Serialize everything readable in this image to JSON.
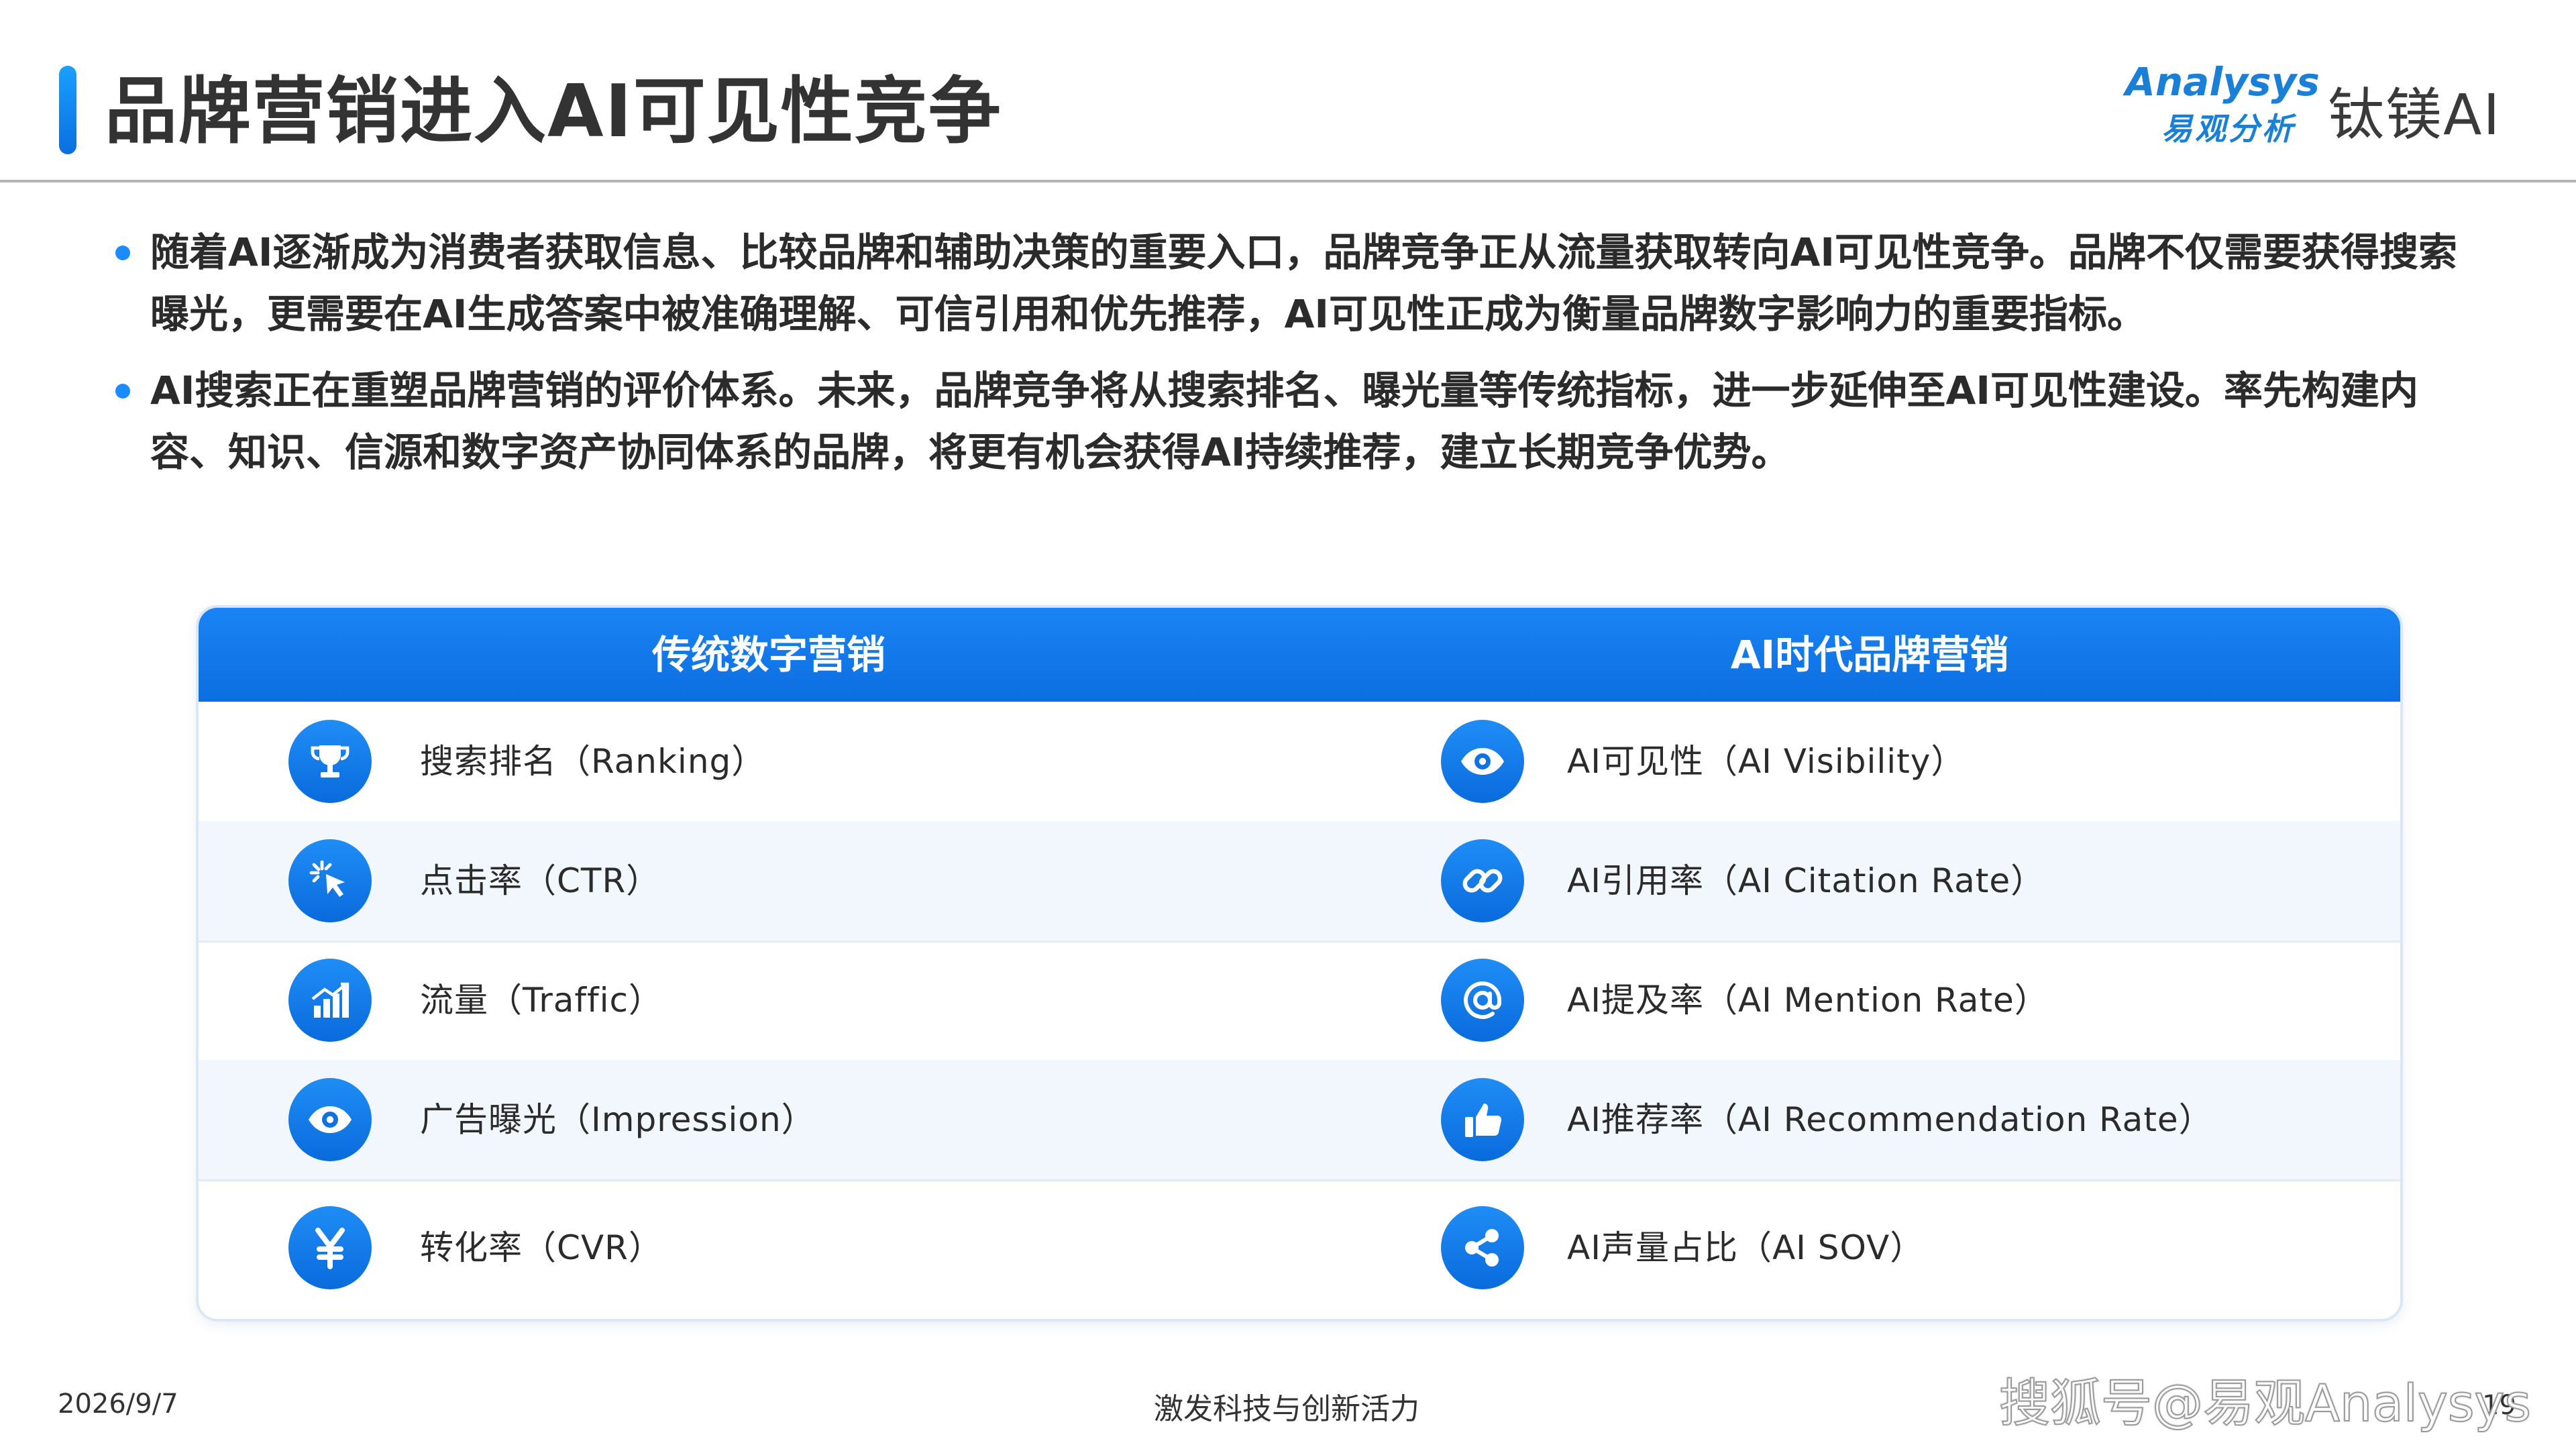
{
  "header": {
    "title": "品牌营销进入AI可见性竞争",
    "logo_analysys_wordmark": "Analysys",
    "logo_analysys_cn": "易观分析",
    "logo_tiemei": "钛镁AI"
  },
  "bullets": [
    "随着AI逐渐成为消费者获取信息、比较品牌和辅助决策的重要入口，品牌竞争正从流量获取转向AI可见性竞争。品牌不仅需要获得搜索曝光，更需要在AI生成答案中被准确理解、可信引用和优先推荐，AI可见性正成为衡量品牌数字影响力的重要指标。",
    "AI搜索正在重塑品牌营销的评价体系。未来，品牌竞争将从搜索排名、曝光量等传统指标，进一步延伸至AI可见性建设。率先构建内容、知识、信源和数字资产协同体系的品牌，将更有机会获得AI持续推荐，建立长期竞争优势。"
  ],
  "table": {
    "left_header": "传统数字营销",
    "right_header": "AI时代品牌营销",
    "rows": [
      {
        "left": "搜索排名（Ranking）",
        "left_icon": "trophy-icon",
        "right": "AI可见性（AI Visibility）",
        "right_icon": "eye-icon"
      },
      {
        "left": "点击率（CTR）",
        "left_icon": "cursor-click-icon",
        "right": "AI引用率（AI Citation Rate）",
        "right_icon": "link-icon"
      },
      {
        "left": "流量（Traffic）",
        "left_icon": "bar-chart-icon",
        "right": "AI提及率（AI Mention Rate）",
        "right_icon": "at-sign-icon"
      },
      {
        "left": "广告曝光（Impression）",
        "left_icon": "eye-icon",
        "right": "AI推荐率（AI Recommendation Rate）",
        "right_icon": "thumbs-up-icon"
      },
      {
        "left": "转化率（CVR）",
        "left_icon": "yen-icon",
        "right": "AI声量占比（AI SOV）",
        "right_icon": "share-icon"
      }
    ]
  },
  "footer": {
    "date": "2026/9/7",
    "slogan": "激发科技与创新活力",
    "watermark": "搜狐号@易观Analysys",
    "page": "19"
  },
  "colors": {
    "accent": "#1a84f4",
    "accent_dark": "#0a6bdc",
    "row_alt": "#f2f7fd",
    "text": "#2b2b2b"
  }
}
